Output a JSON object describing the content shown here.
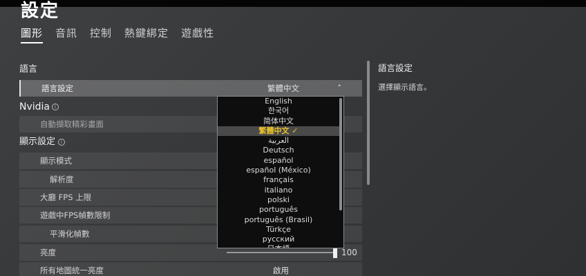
{
  "page_title": "設定",
  "tabs": [
    {
      "label": "圖形"
    },
    {
      "label": "音訊"
    },
    {
      "label": "控制"
    },
    {
      "label": "熱鍵綁定"
    },
    {
      "label": "遊戲性"
    }
  ],
  "sections": {
    "language": "語言",
    "nvidia": "Nvidia",
    "display": "顯示設定"
  },
  "rows": {
    "language_setting": {
      "label": "語言設定",
      "value": "繁體中文"
    },
    "auto_capture": {
      "label": "自動擷取精彩畫面"
    },
    "display_mode": {
      "label": "顯示模式"
    },
    "resolution": {
      "label": "解析度"
    },
    "lobby_fps": {
      "label": "大廳 FPS 上限"
    },
    "ingame_fps": {
      "label": "遊戲中FPS幀數限制"
    },
    "smoothing": {
      "label": "平滑化幀數"
    },
    "brightness": {
      "label": "亮度",
      "value": "100",
      "level": 1.0
    },
    "map_brightness": {
      "label": "所有地圖統一亮度",
      "value": "啟用"
    }
  },
  "dropdown": {
    "options": [
      "English",
      "한국어",
      "简体中文",
      "繁體中文 ✓",
      "العربية",
      "Deutsch",
      "español",
      "español (México)",
      "français",
      "italiano",
      "polski",
      "português",
      "português (Brasil)",
      "Türkçe",
      "русский",
      "日本語"
    ],
    "selected_index": 3
  },
  "help": {
    "title": "語言設定",
    "text": "選擇顯示語言。"
  },
  "colors": {
    "selected_option": "#e8c12a"
  },
  "icons": [
    "info-icon",
    "chevron-up-icon"
  ]
}
